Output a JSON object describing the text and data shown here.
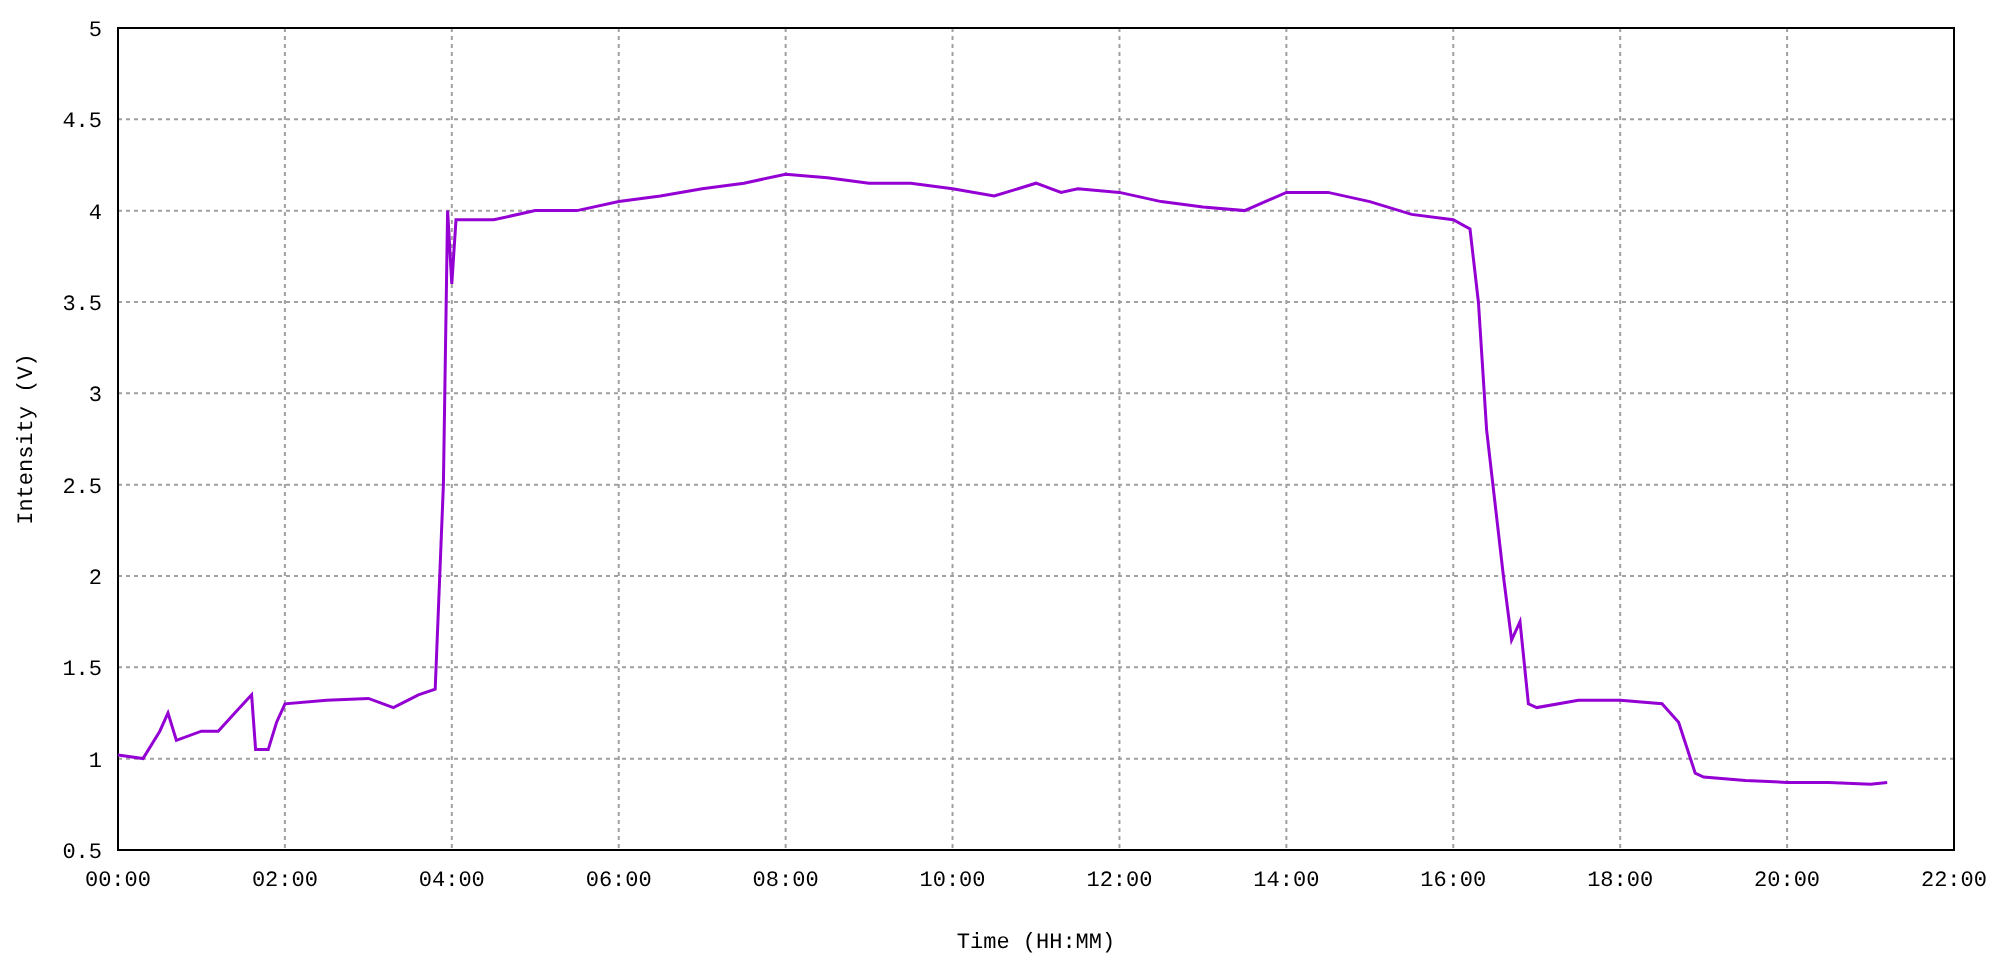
{
  "chart_data": {
    "type": "line",
    "xlabel": "Time (HH:MM)",
    "ylabel": "Intensity (V)",
    "x": [
      0,
      0.3,
      0.5,
      0.6,
      0.7,
      1.0,
      1.2,
      1.4,
      1.6,
      1.65,
      1.8,
      1.9,
      2.0,
      2.5,
      3.0,
      3.3,
      3.6,
      3.8,
      3.9,
      3.95,
      4.0,
      4.05,
      4.5,
      5.0,
      5.5,
      6.0,
      6.5,
      7.0,
      7.5,
      8.0,
      8.5,
      9.0,
      9.5,
      10.0,
      10.5,
      11.0,
      11.3,
      11.5,
      12.0,
      12.5,
      13.0,
      13.5,
      14.0,
      14.5,
      15.0,
      15.5,
      16.0,
      16.2,
      16.3,
      16.4,
      16.6,
      16.7,
      16.8,
      16.9,
      17.0,
      17.5,
      18.0,
      18.5,
      18.7,
      18.9,
      19.0,
      19.5,
      20.0,
      20.5,
      21.0,
      21.2
    ],
    "series": [
      {
        "color": "#9400d3",
        "values": [
          1.02,
          1.0,
          1.15,
          1.25,
          1.1,
          1.15,
          1.15,
          1.25,
          1.35,
          1.05,
          1.05,
          1.2,
          1.3,
          1.32,
          1.33,
          1.28,
          1.35,
          1.38,
          2.5,
          4.0,
          3.6,
          3.95,
          3.95,
          4.0,
          4.0,
          4.05,
          4.08,
          4.12,
          4.15,
          4.2,
          4.18,
          4.15,
          4.15,
          4.12,
          4.08,
          4.15,
          4.1,
          4.12,
          4.1,
          4.05,
          4.02,
          4.0,
          4.1,
          4.1,
          4.05,
          3.98,
          3.95,
          3.9,
          3.5,
          2.8,
          2.0,
          1.65,
          1.75,
          1.3,
          1.28,
          1.32,
          1.32,
          1.3,
          1.2,
          0.92,
          0.9,
          0.88,
          0.87,
          0.87,
          0.86,
          0.87
        ]
      }
    ],
    "xlim": [
      0,
      22
    ],
    "ylim": [
      0.5,
      5
    ],
    "xticks": [
      {
        "value": 0,
        "label": "00:00"
      },
      {
        "value": 2,
        "label": "02:00"
      },
      {
        "value": 4,
        "label": "04:00"
      },
      {
        "value": 6,
        "label": "06:00"
      },
      {
        "value": 8,
        "label": "08:00"
      },
      {
        "value": 10,
        "label": "10:00"
      },
      {
        "value": 12,
        "label": "12:00"
      },
      {
        "value": 14,
        "label": "14:00"
      },
      {
        "value": 16,
        "label": "16:00"
      },
      {
        "value": 18,
        "label": "18:00"
      },
      {
        "value": 20,
        "label": "20:00"
      },
      {
        "value": 22,
        "label": "22:00"
      }
    ],
    "yticks": [
      0.5,
      1,
      1.5,
      2,
      2.5,
      3,
      3.5,
      4,
      4.5,
      5
    ],
    "grid": true
  }
}
